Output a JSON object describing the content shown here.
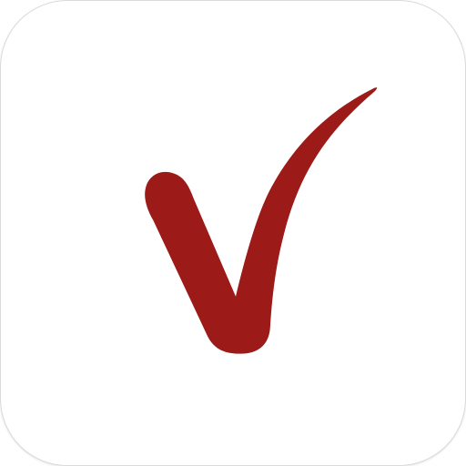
{
  "app_icon": {
    "icon": "checkmark-icon",
    "colors": {
      "background": "#ffffff",
      "checkmark": "#9c1a17",
      "border": "#dadada"
    }
  }
}
